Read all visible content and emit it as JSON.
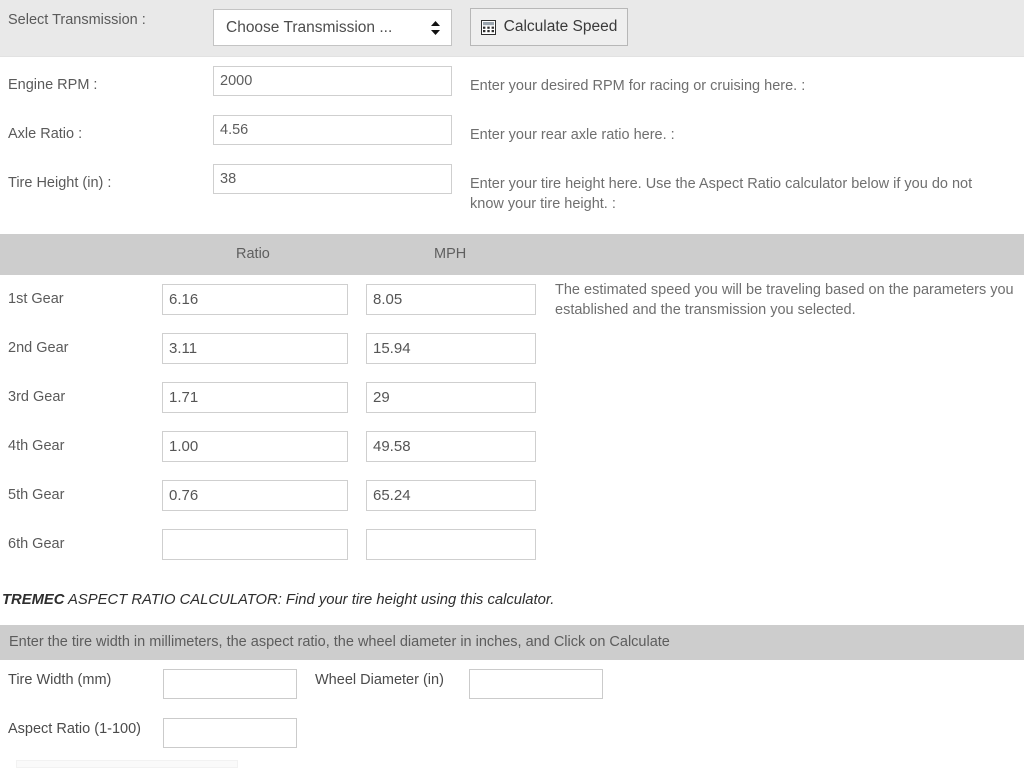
{
  "transmission_bar": {
    "label": "Select Transmission :",
    "select": {
      "value": "Choose Transmission ...",
      "icon": "updown-arrows-icon"
    },
    "calculate_button": {
      "label": "Calculate Speed",
      "icon": "calculator-icon"
    }
  },
  "parameters": [
    {
      "label": "Engine RPM :",
      "value": "2000",
      "help": "Enter your desired RPM for racing or cruising here. :"
    },
    {
      "label": "Axle Ratio :",
      "value": "4.56",
      "help": "Enter your rear axle ratio here. :"
    },
    {
      "label": "Tire Height (in) :",
      "value": "38",
      "help": "Enter your tire height here. Use the Aspect Ratio calculator below if you do not know your tire height. :"
    }
  ],
  "gear_table": {
    "headers": {
      "ratio": "Ratio",
      "mph": "MPH"
    },
    "rows": [
      {
        "gear": "1st Gear",
        "ratio": "6.16",
        "mph": "8.05"
      },
      {
        "gear": "2nd Gear",
        "ratio": "3.11",
        "mph": "15.94"
      },
      {
        "gear": "3rd Gear",
        "ratio": "1.71",
        "mph": "29"
      },
      {
        "gear": "4th Gear",
        "ratio": "1.00",
        "mph": "49.58"
      },
      {
        "gear": "5th Gear",
        "ratio": "0.76",
        "mph": "65.24"
      },
      {
        "gear": "6th Gear",
        "ratio": "",
        "mph": ""
      }
    ],
    "note": "The estimated speed you will be traveling based on the parameters you established and the transmission you selected."
  },
  "aspect_calculator": {
    "title_brand": "TREMEC",
    "title_rest": " ASPECT RATIO CALCULATOR: Find your tire height using this calculator.",
    "instructions": "Enter the tire width in millimeters, the aspect ratio, the wheel diameter in inches, and Click on Calculate",
    "fields": [
      {
        "label": "Tire Width (mm)",
        "value": ""
      },
      {
        "label": "Wheel Diameter (in)",
        "value": ""
      },
      {
        "label": "Aspect Ratio (1-100)",
        "value": ""
      }
    ]
  },
  "colors": {
    "bar_gray": "#cdcdcd",
    "topbar_gray": "#e9e9e9",
    "text_gray": "#5a5a5a",
    "input_border": "#cfcfcf",
    "button_face": "#efefef"
  }
}
